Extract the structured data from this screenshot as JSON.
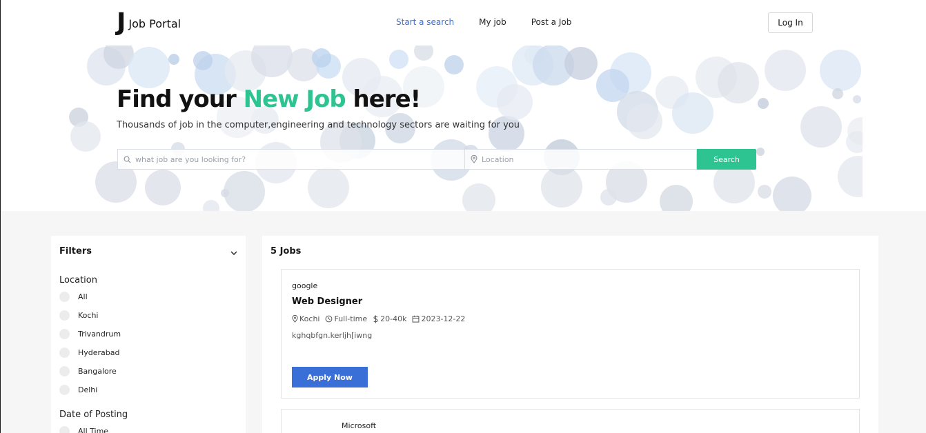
{
  "header": {
    "logo_mark": "J",
    "logo_text": "Job Portal",
    "nav": [
      {
        "label": "Start a search",
        "active": true
      },
      {
        "label": "My job",
        "active": false
      },
      {
        "label": "Post a Job",
        "active": false
      }
    ],
    "login_label": "Log In"
  },
  "hero": {
    "title_before": "Find your ",
    "title_accent": "New Job",
    "title_after": " here!",
    "subtitle": "Thousands of job in the computer,engineering and technology sectors are waiting for you",
    "search_placeholder": "what job are you looking for?",
    "location_placeholder": "Location",
    "search_button": "Search"
  },
  "filters": {
    "title": "Filters",
    "location_title": "Location",
    "locations": [
      "All",
      "Kochi",
      "Trivandrum",
      "Hyderabad",
      "Bangalore",
      "Delhi"
    ],
    "date_title": "Date of Posting",
    "dates": [
      "All Time"
    ]
  },
  "jobs": {
    "count_label": "5 Jobs",
    "items": [
      {
        "company": "google",
        "title": "Web Designer",
        "location": "Kochi",
        "type": "Full-time",
        "salary": "20-40k",
        "date": "2023-12-22",
        "description": "kghqbfgn.kerljh[iwng",
        "apply_label": "Apply Now"
      },
      {
        "company": "Microsoft"
      }
    ]
  },
  "colors": {
    "accent_green": "#2ec491",
    "primary_blue": "#3a6fd8"
  }
}
